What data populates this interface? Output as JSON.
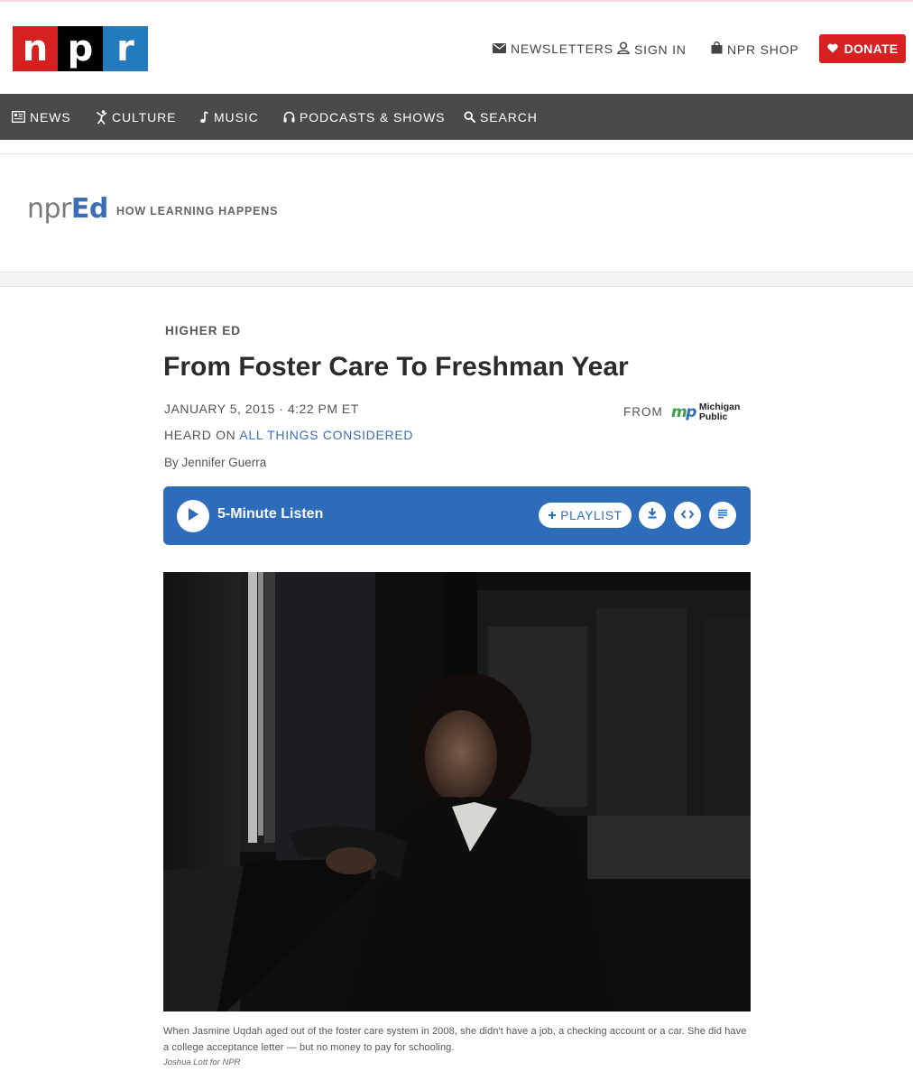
{
  "brand": {
    "logo_letters": [
      "n",
      "p",
      "r"
    ],
    "colors": {
      "n": "#d62021",
      "p": "#000000",
      "r": "#237bbd"
    }
  },
  "utility_nav": {
    "newsletters": {
      "label": "NEWSLETTERS",
      "icon": "envelope-icon"
    },
    "sign_in": {
      "label": "SIGN IN",
      "icon": "user-icon"
    },
    "shop": {
      "label": "NPR SHOP",
      "icon": "shopping-bag-icon"
    },
    "donate": {
      "label": "DONATE",
      "icon": "heart-icon",
      "color": "#d62021"
    }
  },
  "main_nav": {
    "items": [
      {
        "label": "NEWS",
        "icon": "newspaper-icon"
      },
      {
        "label": "CULTURE",
        "icon": "dancer-icon"
      },
      {
        "label": "MUSIC",
        "icon": "music-note-icon"
      },
      {
        "label": "PODCASTS & SHOWS",
        "icon": "headphones-icon"
      },
      {
        "label": "SEARCH",
        "icon": "search-icon"
      }
    ]
  },
  "section": {
    "brand_prefix": "npr",
    "brand_suffix": "Ed",
    "tagline": "HOW LEARNING HAPPENS"
  },
  "article": {
    "slug": "HIGHER ED",
    "title": "From Foster Care To Freshman Year",
    "date": "JANUARY 5, 2015 · 4:22 PM ET",
    "heard_on_prefix": "HEARD ON ",
    "heard_on_show": "ALL THINGS CONSIDERED",
    "byline_prefix": "By ",
    "author": "Jennifer Guerra",
    "from_label": "FROM",
    "station": {
      "mark": "mp",
      "name_line1": "Michigan",
      "name_line2": "Public"
    }
  },
  "player": {
    "listen_label": "5-Minute Listen",
    "playlist_label": "PLAYLIST",
    "accent": "#2d6cb9"
  },
  "photo": {
    "caption": "When Jasmine Uqdah aged out of the foster care system in 2008, she didn't have a job, a checking account or a car. She did have a college acceptance letter — but no money to pay for schooling.",
    "credit": "Joshua Lott for NPR"
  }
}
